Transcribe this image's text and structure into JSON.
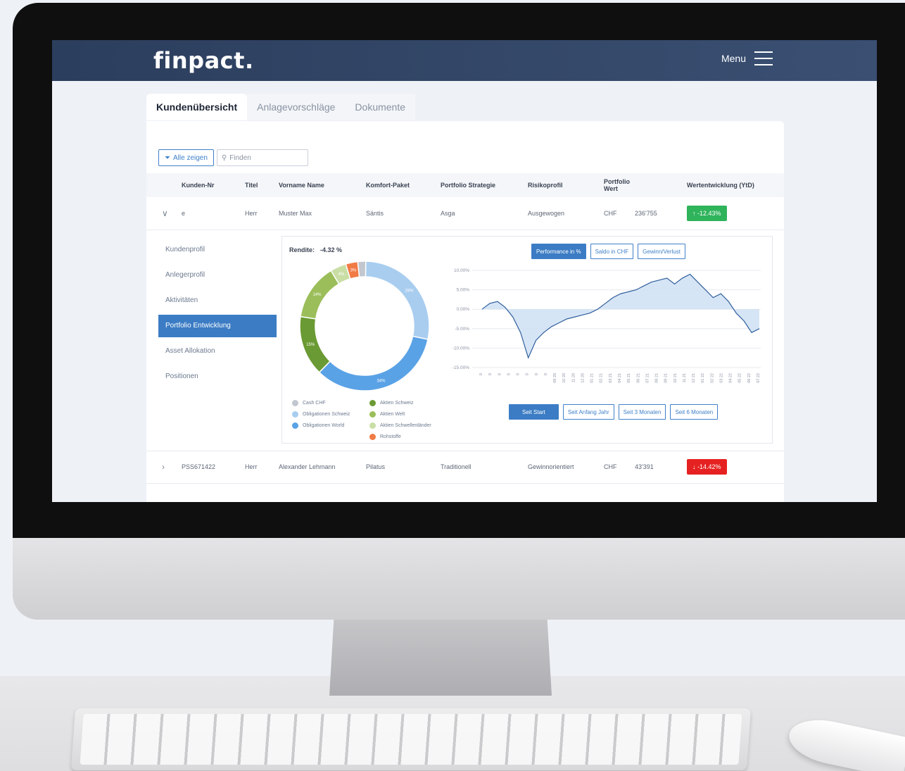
{
  "brand": {
    "logo": "finpact.",
    "menu_label": "Menu"
  },
  "tabs": [
    {
      "label": "Kundenübersicht",
      "active": true
    },
    {
      "label": "Anlagevorschläge",
      "active": false
    },
    {
      "label": "Dokumente",
      "active": false
    }
  ],
  "toolbar": {
    "show_all_label": "Alle zeigen",
    "search_placeholder": "Finden"
  },
  "table": {
    "headers": [
      "",
      "Kunden-Nr",
      "Titel",
      "Vorname Name",
      "Komfort-Paket",
      "Portfolio Strategie",
      "Risikoprofil",
      "Portfolio Wert",
      "",
      "Wertentwicklung (YtD)"
    ],
    "rows": [
      {
        "kunden_nr": "e",
        "titel": "Herr",
        "name": "Muster Max",
        "paket": "Säntis",
        "strategie": "Asga",
        "risiko": "Ausgewogen",
        "currency": "CHF",
        "wert": "236'755",
        "ytd": "-12.43%",
        "ytd_status": "positive"
      },
      {
        "kunden_nr": "PSS671422",
        "titel": "Herr",
        "name": "Alexander Lehmann",
        "paket": "Pilatus",
        "strategie": "Traditionell",
        "risiko": "Gewinnorientiert",
        "currency": "CHF",
        "wert": "43'391",
        "ytd": "-14.42%",
        "ytd_status": "negative"
      }
    ]
  },
  "sidenav": [
    {
      "label": "Kundenprofil",
      "active": false
    },
    {
      "label": "Anlegerprofil",
      "active": false
    },
    {
      "label": "Aktivitäten",
      "active": false
    },
    {
      "label": "Portfolio Entwicklung",
      "active": true
    },
    {
      "label": "Asset Allokation",
      "active": false
    },
    {
      "label": "Positionen",
      "active": false
    }
  ],
  "rendite": {
    "label": "Rendite:",
    "value": "-4.32 %"
  },
  "view_buttons": [
    {
      "label": "Performance in %",
      "active": true
    },
    {
      "label": "Saldo in CHF",
      "active": false
    },
    {
      "label": "Gewinn/Verlust",
      "active": false
    }
  ],
  "range_buttons": [
    {
      "label": "Seit Start",
      "active": true
    },
    {
      "label": "Seit Anfang Jahr",
      "active": false
    },
    {
      "label": "Seit 3 Monaten",
      "active": false
    },
    {
      "label": "Seit 6 Monaten",
      "active": false
    }
  ],
  "legend": [
    {
      "label": "Cash CHF",
      "color": "#c2c7cf"
    },
    {
      "label": "Aktien Schweiz",
      "color": "#6a9a33"
    },
    {
      "label": "Obligationen Schweiz",
      "color": "#a8cdef"
    },
    {
      "label": "Aktien Welt",
      "color": "#9bbe5a"
    },
    {
      "label": "Obligationen World",
      "color": "#5aa2e6"
    },
    {
      "label": "Aktien Schwellenländer",
      "color": "#c9dea5"
    },
    {
      "label": "",
      "color": ""
    },
    {
      "label": "Rohstoffe",
      "color": "#f07b45"
    }
  ],
  "chart_data": [
    {
      "type": "pie",
      "variant": "donut",
      "slices": [
        {
          "label": "Obligationen Schweiz",
          "value": 28,
          "display": "28%",
          "color": "#a8cdef"
        },
        {
          "label": "Obligationen World",
          "value": 34,
          "display": "34%",
          "color": "#5aa2e6"
        },
        {
          "label": "Aktien Schweiz",
          "value": 15,
          "display": "15%",
          "color": "#6a9a33"
        },
        {
          "label": "Aktien Welt",
          "value": 14,
          "display": "14%",
          "color": "#9bbe5a"
        },
        {
          "label": "Aktien Schwellenländer",
          "value": 4,
          "display": "4%",
          "color": "#c9dea5"
        },
        {
          "label": "Rohstoffe",
          "value": 3,
          "display": "3%",
          "color": "#f07b45"
        },
        {
          "label": "Cash CHF",
          "value": 2,
          "display": "",
          "color": "#c2c7cf"
        }
      ]
    },
    {
      "type": "area",
      "yticks": [
        "10.00%",
        "5.00%",
        "0.00%",
        "-5.00%",
        "-10.00%",
        "-15.00%"
      ],
      "ylim": [
        -15,
        10
      ],
      "xticks": [
        "0",
        "0",
        "0",
        "0",
        "0",
        "0",
        "0",
        "0",
        "09 20",
        "10 20",
        "11 20",
        "12 20",
        "01 21",
        "02 21",
        "03 21",
        "04 21",
        "05 21",
        "06 21",
        "07 21",
        "08 21",
        "09 21",
        "10 21",
        "11 21",
        "12 21",
        "01 22",
        "02 22",
        "03 22",
        "04 22",
        "05 22",
        "06 22",
        "07 22"
      ],
      "values": [
        0,
        1.5,
        2,
        0.5,
        -2,
        -6,
        -12.5,
        -8,
        -6,
        -4.5,
        -3.5,
        -2.5,
        -2,
        -1.5,
        -1,
        0,
        1.5,
        3,
        4,
        4.5,
        5,
        6,
        7,
        7.5,
        8,
        6.5,
        8,
        9,
        7,
        5,
        3,
        4,
        2,
        -1,
        -3,
        -6,
        -5
      ]
    }
  ]
}
